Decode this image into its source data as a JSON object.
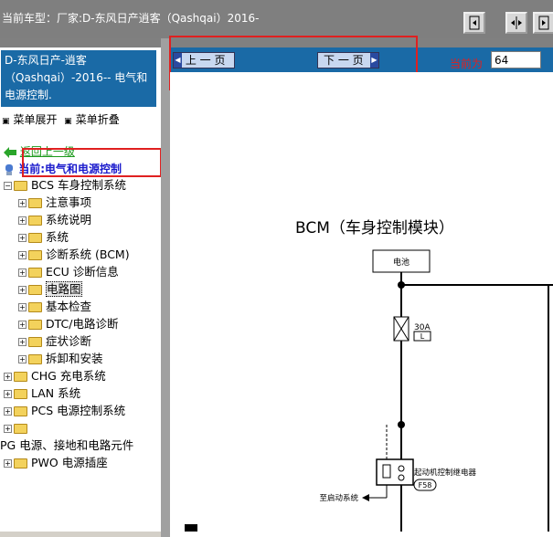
{
  "window": {
    "title": "当前车型：厂家:D-东风日产逍客（Qashqai）2016-"
  },
  "toolbar": {
    "buttons": [
      {
        "icon": "collapse-left-icon"
      },
      {
        "icon": "split-view-icon"
      },
      {
        "icon": "expand-right-icon"
      }
    ]
  },
  "sidebar": {
    "heading": "D-东风日产-逍客（Qashqai）-2016-- 电气和电源控制.",
    "menu_expand": "菜单展开",
    "menu_collapse": "菜单折叠",
    "back_link": "返回上一级",
    "current": "当前:电气和电源控制",
    "tree": [
      {
        "label": "BCS 车身控制系统",
        "level": 0,
        "expanded": true
      },
      {
        "label": "注意事项",
        "level": 1
      },
      {
        "label": "系统说明",
        "level": 1
      },
      {
        "label": "系统",
        "level": 1
      },
      {
        "label": "诊断系统 (BCM)",
        "level": 1
      },
      {
        "label": "ECU 诊断信息",
        "level": 1
      },
      {
        "label": "电路图",
        "level": 1,
        "selected": true
      },
      {
        "label": "基本检查",
        "level": 1
      },
      {
        "label": "DTC/电路诊断",
        "level": 1
      },
      {
        "label": "症状诊断",
        "level": 1
      },
      {
        "label": "拆卸和安装",
        "level": 1
      },
      {
        "label": "CHG 充电系统",
        "level": 0
      },
      {
        "label": "LAN 系统",
        "level": 0
      },
      {
        "label": "PCS 电源控制系统",
        "level": 0
      },
      {
        "label": "",
        "level": 0
      },
      {
        "label": "PG 电源、接地和电路元件",
        "level": -1
      },
      {
        "label": "PWO 电源插座",
        "level": 0
      }
    ]
  },
  "nav": {
    "prev_label": "上 一 页",
    "next_label": "下 一 页",
    "current_label": "当前为",
    "current_page": "64"
  },
  "diagram": {
    "title": "BCM（车身控制模块）",
    "battery_label": "电池",
    "fuse_rating": "30A",
    "fuse_type": "L",
    "relay_label": "起动机控制继电器",
    "relay_connector": "F58",
    "starter_label": "至启动系统"
  },
  "colors": {
    "accent_blue": "#1a6aa6",
    "highlight_red": "#e02020",
    "link_green": "#1c9a1c"
  }
}
